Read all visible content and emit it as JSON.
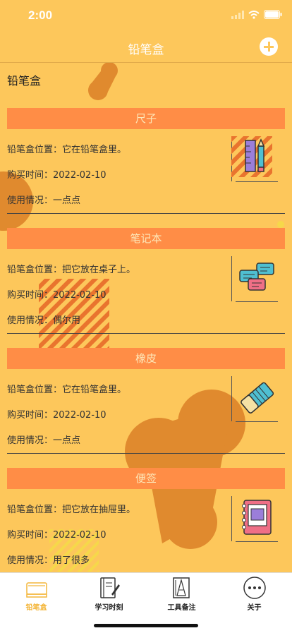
{
  "status": {
    "time": "2:00"
  },
  "nav": {
    "title": "铅笔盒"
  },
  "section": {
    "title": "铅笔盒"
  },
  "items": [
    {
      "name": "尺子",
      "location": "铅笔盒位置：它在铅笔盒里。",
      "date": "购买时间：2022-02-10",
      "usage": "使用情况：一点点",
      "icon": "ruler-pencil-icon"
    },
    {
      "name": "笔记本",
      "location": "铅笔盒位置：把它放在桌子上。",
      "date": "购买时间：2022-02-10",
      "usage": "使用情况：偶尔用",
      "icon": "chat-bubbles-icon"
    },
    {
      "name": "橡皮",
      "location": "铅笔盒位置：它在铅笔盒里。",
      "date": "购买时间：2022-02-10",
      "usage": "使用情况：一点点",
      "icon": "eraser-icon"
    },
    {
      "name": "便签",
      "location": "铅笔盒位置：把它放在抽屉里。",
      "date": "购买时间：2022-02-10",
      "usage": "使用情况：用了很多",
      "icon": "notebook-icon"
    }
  ],
  "tabs": [
    {
      "label": "铅笔盒",
      "icon": "pencil-box-icon",
      "active": true
    },
    {
      "label": "学习时刻",
      "icon": "study-book-icon",
      "active": false
    },
    {
      "label": "工具备注",
      "icon": "tools-ruler-icon",
      "active": false
    },
    {
      "label": "关于",
      "icon": "more-dots-icon",
      "active": false
    }
  ],
  "colors": {
    "background": "#fdc75b",
    "header": "#ff8d46",
    "accent": "#f4b63a",
    "blob": "#e08a2e"
  }
}
